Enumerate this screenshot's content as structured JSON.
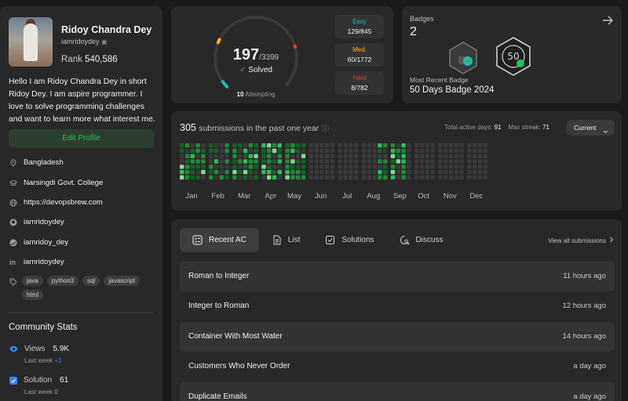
{
  "profile": {
    "name": "Ridoy Chandra Dey",
    "username": "iamridoydey",
    "rank_label": "Rank",
    "rank_value": "540,586",
    "bio": "Hello I am Ridoy Chandra Dey in short Ridoy Dey. I am aspire programmer. I love to solve programming challenges and want to learn more what interest me.",
    "edit_label": "Edit Profile",
    "location": "Bangladesh",
    "school": "Narsingdi Govt. College",
    "website": "https://devopsbrew.com",
    "github": "iamridoydey",
    "twitter": "iamridoy_dey",
    "linkedin": "iamridoydey",
    "skills": [
      "java",
      "python3",
      "sql",
      "javascript",
      "html"
    ]
  },
  "community": {
    "title": "Community Stats",
    "views_label": "Views",
    "views_value": "5.9K",
    "views_sub_label": "Last week",
    "views_sub_value": "+1",
    "solution_label": "Solution",
    "solution_value": "61",
    "solution_sub_label": "Last week",
    "solution_sub_value": "0"
  },
  "progress": {
    "solved": "197",
    "total": "/3399",
    "solved_label": "Solved",
    "attempting_count": "10",
    "attempting_label": "Attempting",
    "easy_label": "Easy",
    "easy_value": "129/845",
    "medium_label": "Med.",
    "medium_value": "60/1772",
    "hard_label": "Hard",
    "hard_value": "8/782",
    "colors": {
      "easy": "#1cbaba",
      "medium": "#ffb700",
      "hard": "#f63737",
      "track": "#3a3a3a"
    }
  },
  "badges": {
    "title": "Badges",
    "count": "2",
    "recent_label": "Most Recent Badge",
    "recent_name": "50 Days Badge 2024"
  },
  "heatmap": {
    "count": "305",
    "title_text": "submissions in the past one year",
    "active_label": "Total active days:",
    "active_value": "91",
    "streak_label": "Max streak:",
    "streak_value": "71",
    "select_label": "Current",
    "months": [
      "Jan",
      "Feb",
      "Mar",
      "Apr",
      "May",
      "Jun",
      "Jul",
      "Aug",
      "Sep",
      "Oct",
      "Nov",
      "Dec"
    ]
  },
  "submissions": {
    "tabs": [
      "Recent AC",
      "List",
      "Solutions",
      "Discuss"
    ],
    "view_all": "View all submissions",
    "rows": [
      {
        "title": "Roman to Integer",
        "ago": "11 hours ago"
      },
      {
        "title": "Integer to Roman",
        "ago": "12 hours ago"
      },
      {
        "title": "Container With Most Water",
        "ago": "14 hours ago"
      },
      {
        "title": "Customers Who Never Order",
        "ago": "a day ago"
      },
      {
        "title": "Duplicate Emails",
        "ago": "a day ago"
      }
    ]
  }
}
